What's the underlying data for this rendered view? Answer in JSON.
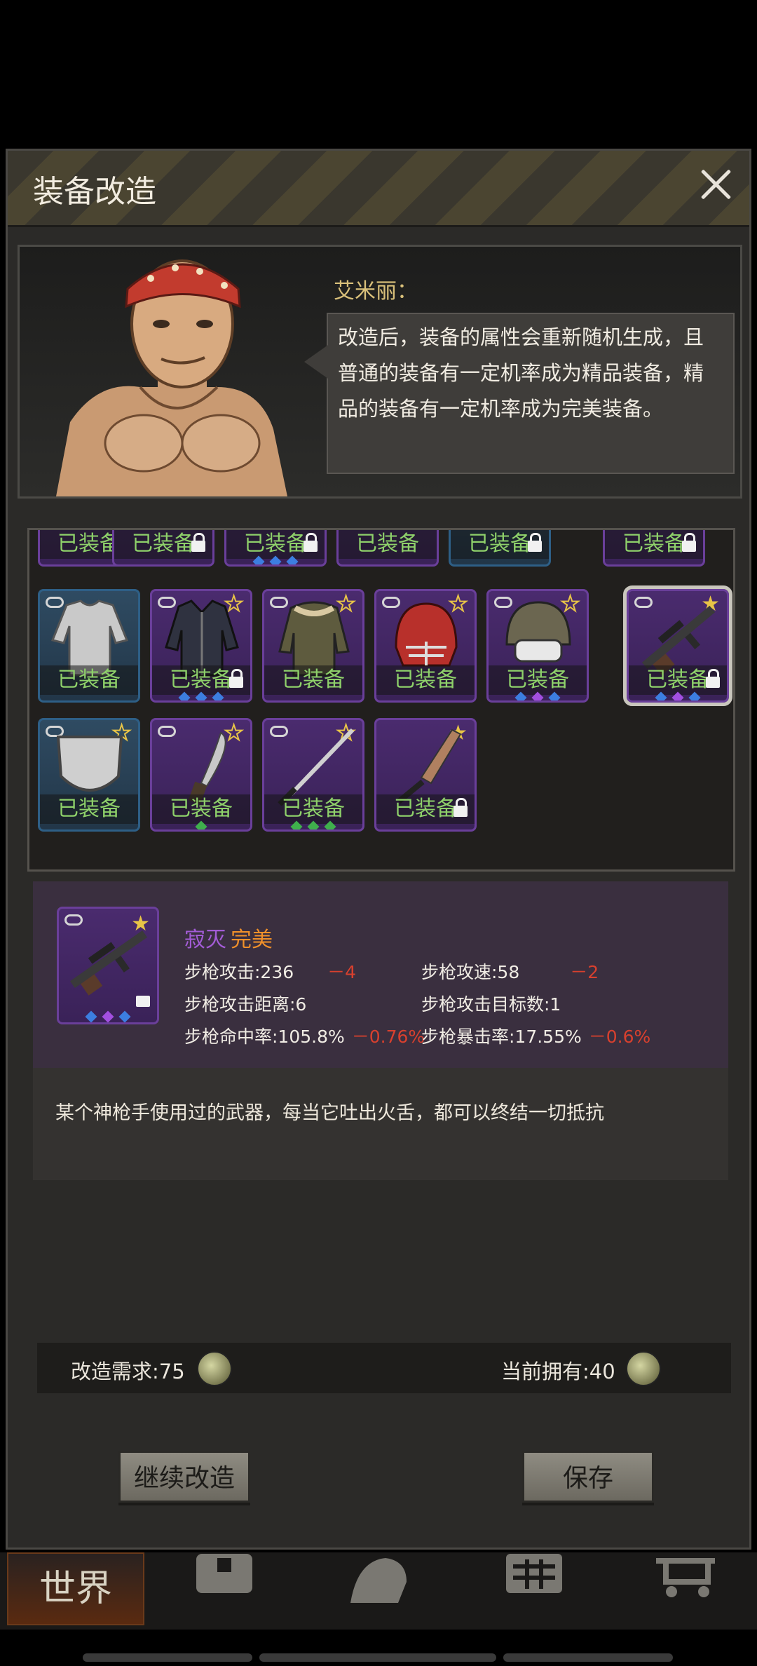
{
  "dialog": {
    "title": "装备改造",
    "npc": {
      "name": "艾米丽：",
      "speech_lines": [
        "改造后，装备的属性会重新随机生成，且",
        "普通的装备有一定机率成为精品装备，精",
        "品的装备有一定机率成为完美装备。"
      ]
    },
    "inventory": {
      "equipped_label": "已装备",
      "rows": [
        [
          "已装备",
          "已装备",
          "已装备",
          "已装备",
          "已装备",
          "已装备"
        ],
        [
          "已装备",
          "已装备",
          "已装备",
          "已装备",
          "已装备",
          "已装备"
        ],
        [
          "已装备",
          "已装备",
          "已装备",
          "已装备"
        ]
      ]
    },
    "selected_item": {
      "name": "寂灭",
      "quality": "完美",
      "stats": [
        {
          "label": "步枪攻击:236",
          "delta": "－4"
        },
        {
          "label": "步枪攻速:58",
          "delta": "－2"
        },
        {
          "label": "步枪攻击距离:6",
          "delta": ""
        },
        {
          "label": "步枪攻击目标数:1",
          "delta": ""
        },
        {
          "label": "步枪命中率:105.8%",
          "delta": "－0.76%"
        },
        {
          "label": "步枪暴击率:17.55%",
          "delta": "－0.6%"
        }
      ],
      "description": "某个神枪手使用过的武器，每当它吐出火舌，都可以终结一切抵抗"
    },
    "cost": {
      "required_label": "改造需求:75",
      "owned_label": "当前拥有:40"
    },
    "buttons": {
      "continue": "继续改造",
      "save": "保存"
    }
  },
  "navbar": {
    "world_label": "世界"
  },
  "colors": {
    "equipped_text": "#8ed06a",
    "epic_name": "#a35cd6",
    "perfect_quality": "#f0902a",
    "negative_delta": "#d8402e"
  }
}
